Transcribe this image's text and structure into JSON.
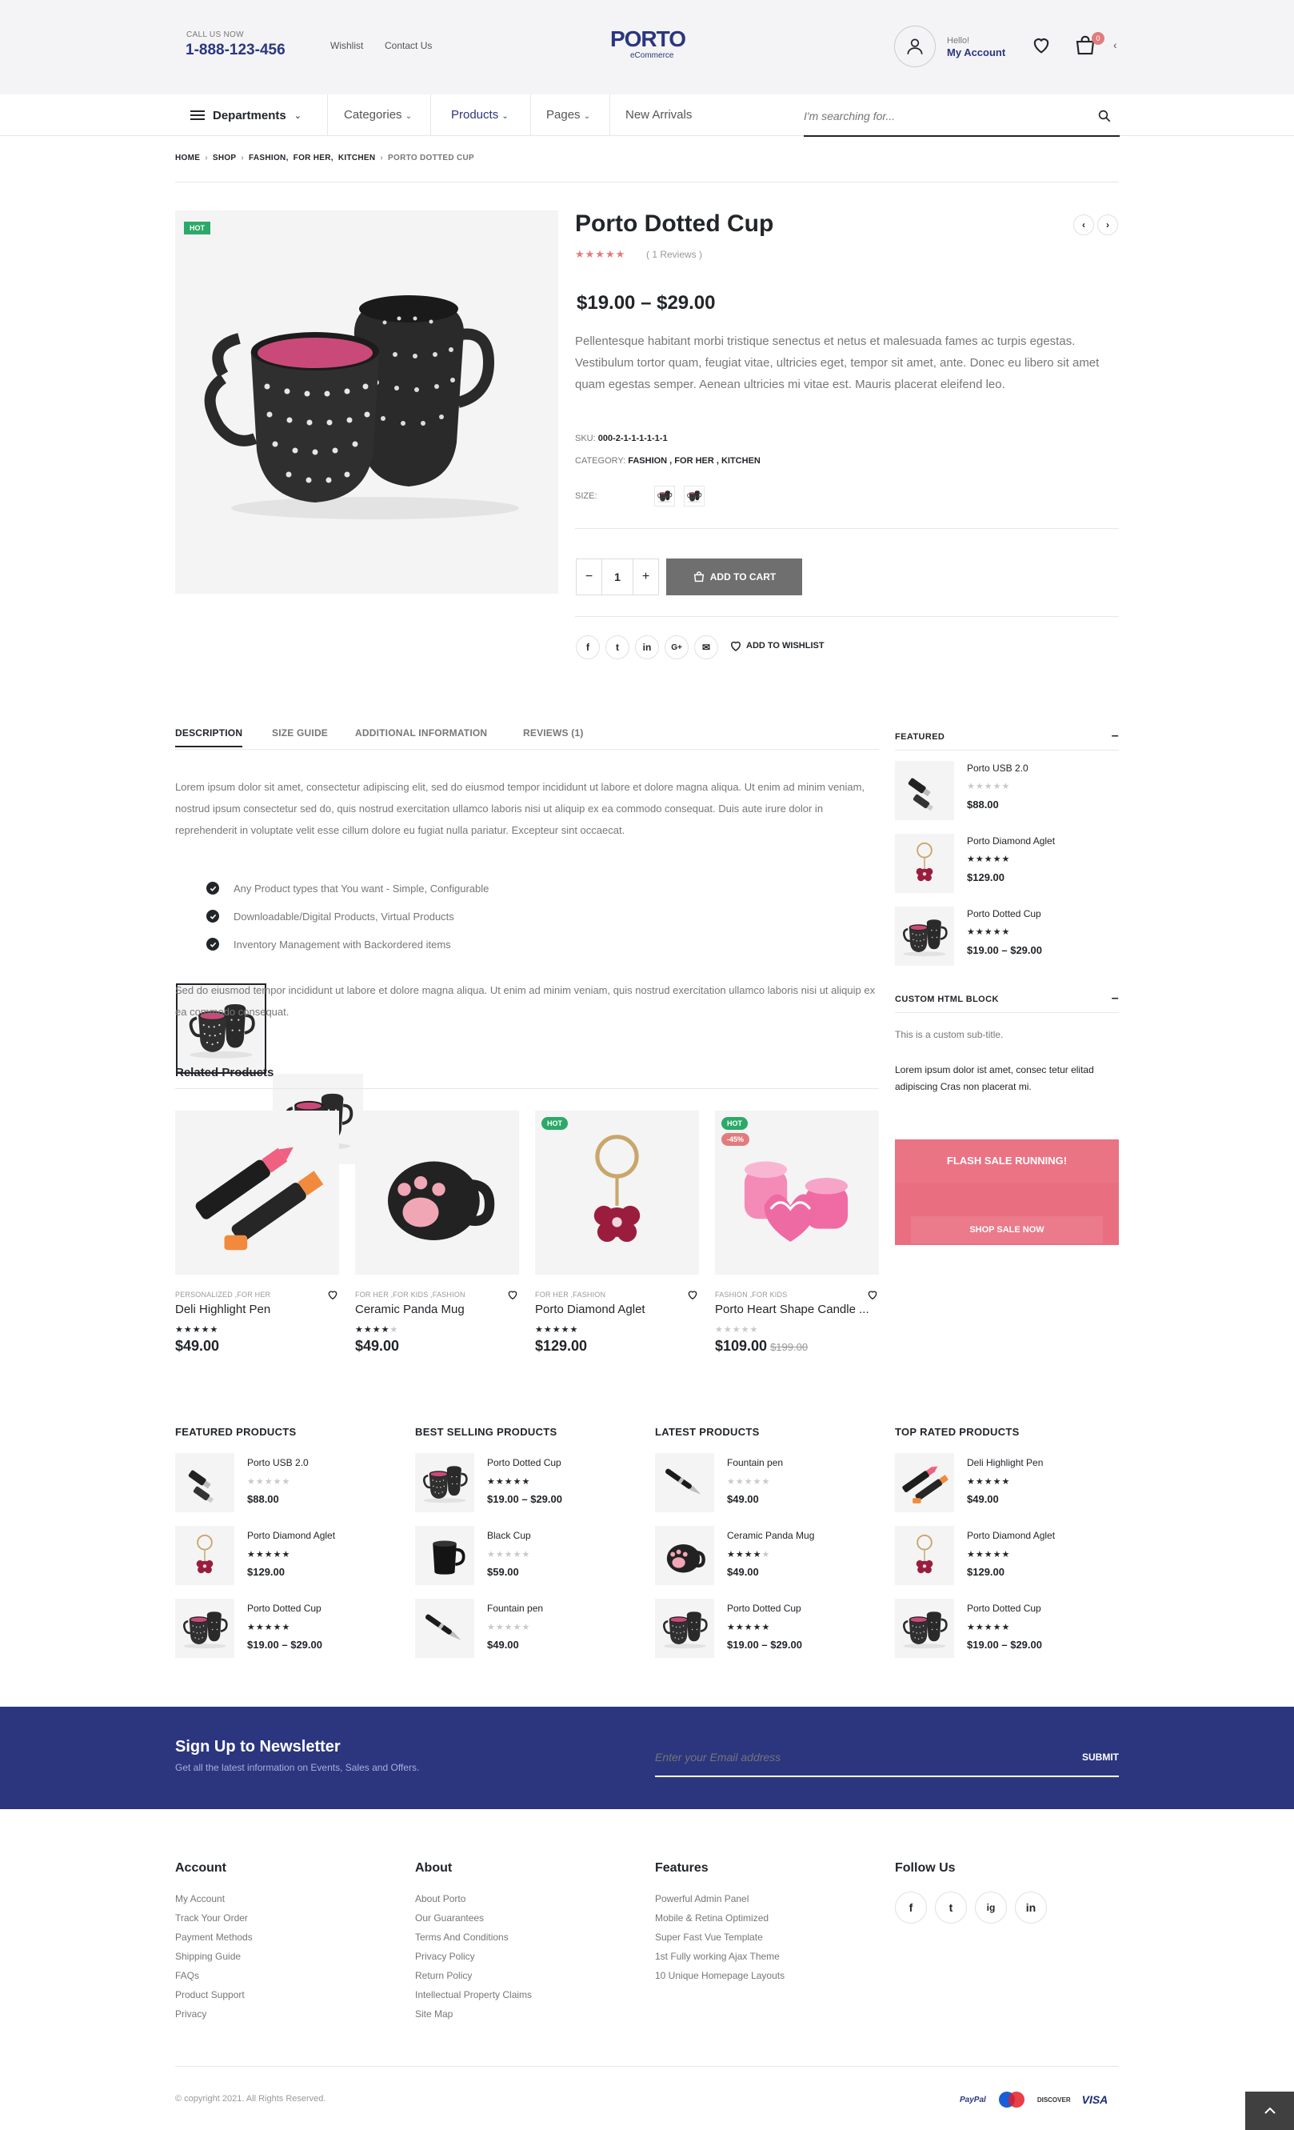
{
  "header": {
    "call_label": "CALL US NOW",
    "phone": "1-888-123-456",
    "links": [
      "Wishlist",
      "Contact Us"
    ],
    "logo": "PORTO",
    "logo_sub": "eCommerce",
    "account_hello": "Hello!",
    "account_label": "My Account",
    "cart_count": "0"
  },
  "nav": {
    "departments": "Departments",
    "items": [
      "Categories",
      "Products",
      "Pages",
      "New Arrivals"
    ],
    "search_placeholder": "I'm searching for..."
  },
  "breadcrumb": [
    "HOME",
    "SHOP",
    "FASHION,",
    "FOR HER,",
    "KITCHEN",
    "PORTO DOTTED CUP"
  ],
  "product": {
    "badge": "HOT",
    "title": "Porto Dotted Cup",
    "reviews": "( 1 Reviews )",
    "rating": 5,
    "price": "$19.00 – $29.00",
    "description": "Pellentesque habitant morbi tristique senectus et netus et malesuada fames ac turpis egestas. Vestibulum tortor quam, feugiat vitae, ultricies eget, tempor sit amet, ante. Donec eu libero sit amet quam egestas semper. Aenean ultricies mi vitae est. Mauris placerat eleifend leo.",
    "sku_label": "SKU:",
    "sku": "000-2-1-1-1-1-1-1",
    "category_label": "CATEGORY:",
    "categories": "FASHION , FOR HER , KITCHEN",
    "size_label": "SIZE:",
    "qty": "1",
    "minus": "−",
    "plus": "+",
    "add_to_cart": "ADD TO CART",
    "add_to_wishlist": "ADD TO WISHLIST",
    "share_icons": [
      "f",
      "t",
      "in",
      "G+",
      "✉"
    ]
  },
  "tabs": {
    "items": [
      "DESCRIPTION",
      "SIZE GUIDE",
      "ADDITIONAL INFORMATION",
      "REVIEWS (1)"
    ],
    "para1": "Lorem ipsum dolor sit amet, consectetur adipiscing elit, sed do eiusmod tempor incididunt ut labore et dolore magna aliqua. Ut enim ad minim veniam, nostrud ipsum consectetur sed do, quis nostrud exercitation ullamco laboris nisi ut aliquip ex ea commodo consequat. Duis aute irure dolor in reprehenderit in voluptate velit esse cillum dolore eu fugiat nulla pariatur. Excepteur sint occaecat.",
    "bullets": [
      "Any Product types that You want - Simple, Configurable",
      "Downloadable/Digital Products, Virtual Products",
      "Inventory Management with Backordered items"
    ],
    "para2": "Sed do eiusmod tempor incididunt ut labore et dolore magna aliqua. Ut enim ad minim veniam, quis nostrud exercitation ullamco laboris nisi ut aliquip ex ea commodo consequat."
  },
  "sidebar": {
    "featured_title": "FEATURED",
    "featured": [
      {
        "name": "Porto USB 2.0",
        "price": "$88.00",
        "rating": 0
      },
      {
        "name": "Porto Diamond Aglet",
        "price": "$129.00",
        "rating": 5
      },
      {
        "name": "Porto Dotted Cup",
        "price": "$19.00 – $29.00",
        "rating": 5
      }
    ],
    "custom_title": "CUSTOM HTML BLOCK",
    "custom_sub": "This is a custom sub-title.",
    "custom_text": "Lorem ipsum dolor ist amet, consec tetur elitad adipiscing Cras non placerat mi.",
    "flash_title": "FLASH SALE RUNNING!",
    "flash_button": "SHOP SALE NOW"
  },
  "related": {
    "title": "Related Products",
    "items": [
      {
        "cats": "PERSONALIZED ,FOR HER",
        "name": "Deli Highlight Pen",
        "price": "$49.00",
        "old": "",
        "rating": 5,
        "badges": []
      },
      {
        "cats": "FOR HER ,FOR KIDS ,FASHION",
        "name": "Ceramic Panda Mug",
        "price": "$49.00",
        "old": "",
        "rating": 4,
        "badges": []
      },
      {
        "cats": "FOR HER ,FASHION",
        "name": "Porto Diamond Aglet",
        "price": "$129.00",
        "old": "",
        "rating": 5,
        "badges": [
          "HOT"
        ]
      },
      {
        "cats": "FASHION ,FOR KIDS",
        "name": "Porto Heart Shape Candle ...",
        "price": "$109.00",
        "old": "$199.00",
        "rating": 0,
        "badges": [
          "HOT",
          "-45%"
        ]
      }
    ]
  },
  "widgets": [
    {
      "title": "FEATURED PRODUCTS",
      "items": [
        {
          "name": "Porto USB 2.0",
          "price": "$88.00",
          "rating": 0,
          "img": "usb"
        },
        {
          "name": "Porto Diamond Aglet",
          "price": "$129.00",
          "rating": 5,
          "img": "aglet"
        },
        {
          "name": "Porto Dotted Cup",
          "price": "$19.00 – $29.00",
          "rating": 5,
          "img": "cup"
        }
      ]
    },
    {
      "title": "BEST SELLING PRODUCTS",
      "items": [
        {
          "name": "Porto Dotted Cup",
          "price": "$19.00 – $29.00",
          "rating": 5,
          "img": "cup"
        },
        {
          "name": "Black Cup",
          "price": "$59.00",
          "rating": 0,
          "img": "blackcup"
        },
        {
          "name": "Fountain pen",
          "price": "$49.00",
          "rating": 0,
          "img": "pen"
        }
      ]
    },
    {
      "title": "LATEST PRODUCTS",
      "items": [
        {
          "name": "Fountain pen",
          "price": "$49.00",
          "rating": 0,
          "img": "pen"
        },
        {
          "name": "Ceramic Panda Mug",
          "price": "$49.00",
          "rating": 4,
          "img": "panda"
        },
        {
          "name": "Porto Dotted Cup",
          "price": "$19.00 – $29.00",
          "rating": 5,
          "img": "cup"
        }
      ]
    },
    {
      "title": "TOP RATED PRODUCTS",
      "items": [
        {
          "name": "Deli Highlight Pen",
          "price": "$49.00",
          "rating": 5,
          "img": "highlighter"
        },
        {
          "name": "Porto Diamond Aglet",
          "price": "$129.00",
          "rating": 5,
          "img": "aglet"
        },
        {
          "name": "Porto Dotted Cup",
          "price": "$19.00 – $29.00",
          "rating": 5,
          "img": "cup"
        }
      ]
    }
  ],
  "newsletter": {
    "title": "Sign Up to Newsletter",
    "subtitle": "Get all the latest information on Events, Sales and Offers.",
    "placeholder": "Enter your Email address",
    "submit": "SUBMIT"
  },
  "footer": {
    "columns": [
      {
        "title": "Account",
        "links": [
          "My Account",
          "Track Your Order",
          "Payment Methods",
          "Shipping Guide",
          "FAQs",
          "Product Support",
          "Privacy"
        ]
      },
      {
        "title": "About",
        "links": [
          "About Porto",
          "Our Guarantees",
          "Terms And Conditions",
          "Privacy Policy",
          "Return Policy",
          "Intellectual Property Claims",
          "Site Map"
        ]
      },
      {
        "title": "Features",
        "links": [
          "Powerful Admin Panel",
          "Mobile & Retina Optimized",
          "Super Fast Vue Template",
          "1st Fully working Ajax Theme",
          "10 Unique Homepage Layouts"
        ]
      }
    ],
    "follow_title": "Follow Us",
    "social": [
      "f",
      "t",
      "ig",
      "in"
    ],
    "copyright": "© copyright 2021. All Rights Reserved.",
    "payments": [
      "PayPal",
      "Maestro",
      "DISCOVER",
      "VISA"
    ]
  },
  "colors": {
    "navy": "#2b367f",
    "hot": "#2ba968",
    "sale": "#e27c7c",
    "flash_top": "#e96f80",
    "flash_bottom": "#e66a79"
  }
}
